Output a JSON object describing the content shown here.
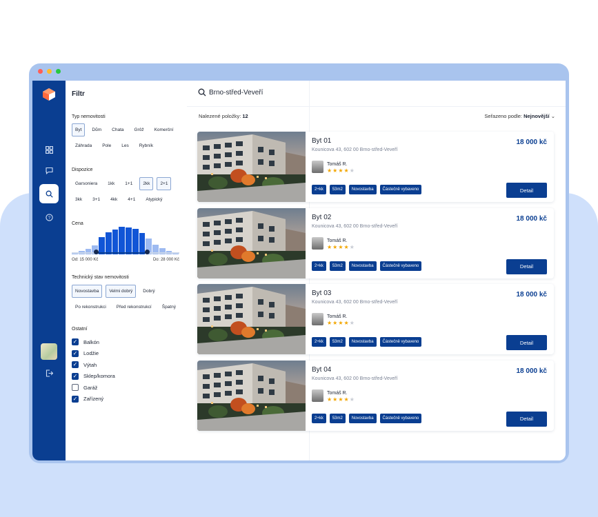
{
  "brand": {
    "accent": "#0a3e91",
    "rail_bg": "#0a3e91",
    "hist_on": "#1155d6",
    "hist_off": "#9dbaf1"
  },
  "window": {
    "traffic_colors": [
      "#ff5f57",
      "#febc2e",
      "#28c840"
    ]
  },
  "rail": {
    "items": [
      "grid-icon",
      "chat-icon",
      "search-icon",
      "help-icon"
    ],
    "active": "search-icon",
    "logout_icon": "logout-icon"
  },
  "filter": {
    "title": "Filtr",
    "typ": {
      "label": "Typ nemovitosti",
      "options": [
        "Byt",
        "Dům",
        "Chata",
        "Grôž",
        "Komerční",
        "Záhrada",
        "Pole",
        "Les",
        "Rybník"
      ],
      "selected": [
        "Byt"
      ]
    },
    "dispozice": {
      "label": "Dispozice",
      "options": [
        "Garsoniera",
        "1kk",
        "1+1",
        "2kk",
        "2+1",
        "3kk",
        "3+1",
        "4kk",
        "4+1",
        "Atypický"
      ],
      "selected": [
        "2kk",
        "2+1"
      ]
    },
    "cena": {
      "label": "Cena",
      "from": "Od: 15 000 Kč",
      "to": "Do: 28 000 Kč",
      "histogram": [
        2,
        4,
        6,
        10,
        19,
        25,
        28,
        31,
        30,
        29,
        24,
        18,
        11,
        7,
        4,
        2
      ],
      "range_fraction": [
        0.23,
        0.7
      ]
    },
    "stav": {
      "label": "Technický stav nemovitosti",
      "options": [
        "Novostavba",
        "Velmi dobrý",
        "Dobrý",
        "Po rekonstrukci",
        "Před rekonstrukcí",
        "Špatný"
      ],
      "selected": [
        "Novostavba",
        "Velmi dobrý"
      ]
    },
    "ostatni": {
      "label": "Ostatní",
      "items": [
        {
          "label": "Balkón",
          "checked": true
        },
        {
          "label": "Lodžie",
          "checked": true
        },
        {
          "label": "Výtah",
          "checked": true
        },
        {
          "label": "Sklep/komora",
          "checked": true
        },
        {
          "label": "Garáž",
          "checked": false
        },
        {
          "label": "Zařízený",
          "checked": true
        }
      ]
    }
  },
  "search": {
    "query": "Brno-střed-Veveří"
  },
  "results": {
    "count_label": "Nalezené položky:",
    "count": "12",
    "sort_label": "Seřazeno podle:",
    "sort_value": "Nejnovější"
  },
  "listings": [
    {
      "name": "Byt 01",
      "address": "Kounicova 43, 602 00 Brno-střed-Veveří",
      "price": "18 000 kč",
      "agent": "Tomáš R.",
      "rating": 4,
      "tags": [
        "2+kk",
        "53m2",
        "Novostavba",
        "Částečně vybaveno"
      ],
      "button": "Detail"
    },
    {
      "name": "Byt 02",
      "address": "Kounicova 43, 602 00 Brno-střed-Veveří",
      "price": "18 000 kč",
      "agent": "Tomáš R.",
      "rating": 4,
      "tags": [
        "2+kk",
        "53m2",
        "Novostavba",
        "Částečně vybaveno"
      ],
      "button": "Detail"
    },
    {
      "name": "Byt 03",
      "address": "Kounicova 43, 602 00 Brno-střed-Veveří",
      "price": "18 000 kč",
      "agent": "Tomáš R.",
      "rating": 4,
      "tags": [
        "2+kk",
        "53m2",
        "Novostavba",
        "Částečně vybaveno"
      ],
      "button": "Detail"
    },
    {
      "name": "Byt 04",
      "address": "Kounicova 43, 602 00 Brno-střed-Veveří",
      "price": "18 000 kč",
      "agent": "Tomáš R.",
      "rating": 4,
      "tags": [
        "2+kk",
        "53m2",
        "Novostavba",
        "Částečně vybaveno"
      ],
      "button": "Detail"
    }
  ]
}
